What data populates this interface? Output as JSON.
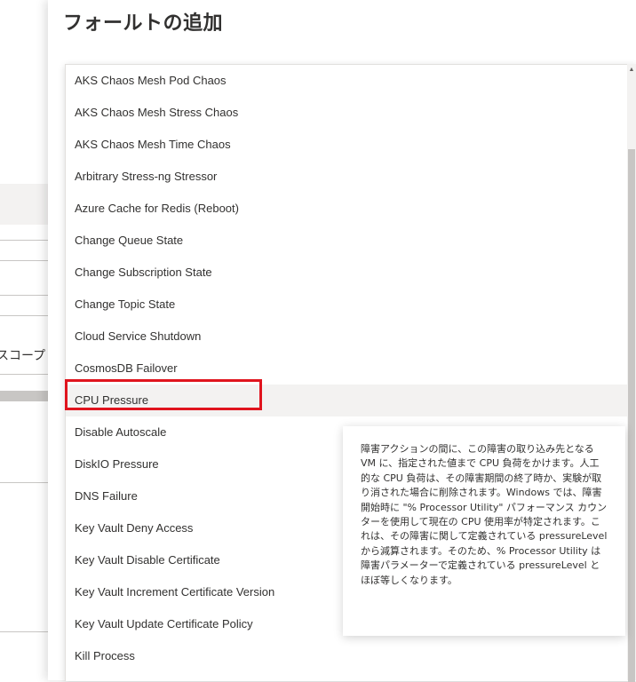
{
  "background": {
    "scope_text": "スコープ"
  },
  "panel": {
    "title": "フォールトの追加"
  },
  "dropdown": {
    "options": [
      "AKS Chaos Mesh Pod Chaos",
      "AKS Chaos Mesh Stress Chaos",
      "AKS Chaos Mesh Time Chaos",
      "Arbitrary Stress-ng Stressor",
      "Azure Cache for Redis (Reboot)",
      "Change Queue State",
      "Change Subscription State",
      "Change Topic State",
      "Cloud Service Shutdown",
      "CosmosDB Failover",
      "CPU Pressure",
      "Disable Autoscale",
      "DiskIO Pressure",
      "DNS Failure",
      "Key Vault Deny Access",
      "Key Vault Disable Certificate",
      "Key Vault Increment Certificate Version",
      "Key Vault Update Certificate Policy",
      "Kill Process"
    ],
    "hovered_option": "CPU Pressure",
    "highlight_color": "#e0141e"
  },
  "tooltip": {
    "text": "障害アクションの間に、この障害の取り込み先となる VM に、指定された値まで CPU 負荷をかけます。人工的な CPU 負荷は、その障害期間の終了時か、実験が取り消された場合に削除されます。Windows では、障害開始時に \"% Processor Utility\" パフォーマンス カウンターを使用して現在の CPU 使用率が特定されます。これは、その障害に関して定義されている pressureLevel から減算されます。そのため、% Processor Utility は障害パラメーターで定義されている pressureLevel とほぼ等しくなります。"
  }
}
